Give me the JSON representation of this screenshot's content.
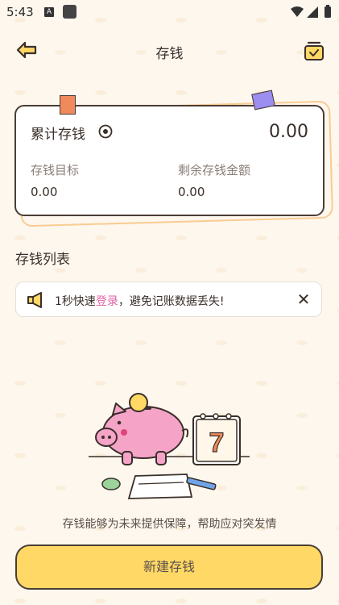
{
  "status_bar": {
    "time": "5:43",
    "notif_icon_letter": "A"
  },
  "header": {
    "title": "存钱",
    "back_icon": "back-arrow-icon",
    "plan_icon": "calendar-check-icon"
  },
  "summary": {
    "total_label": "累计存钱",
    "total_value": "0.00",
    "goal_label": "存钱目标",
    "goal_value": "0.00",
    "remaining_label": "剩余存钱金额",
    "remaining_value": "0.00"
  },
  "list": {
    "title": "存钱列表"
  },
  "notice": {
    "prefix": "1秒快速",
    "link_text": "登录",
    "suffix": "，避免记账数据丢失!",
    "close_symbol": "✕"
  },
  "empty_state": {
    "message": "存钱能够为未来提供保障，帮助应对突发情",
    "calendar_day": "7"
  },
  "actions": {
    "create_label": "新建存钱"
  },
  "colors": {
    "accent": "#ffd866",
    "link": "#e062a6",
    "pig": "#f6a3c8",
    "background": "#fdf7ee"
  }
}
